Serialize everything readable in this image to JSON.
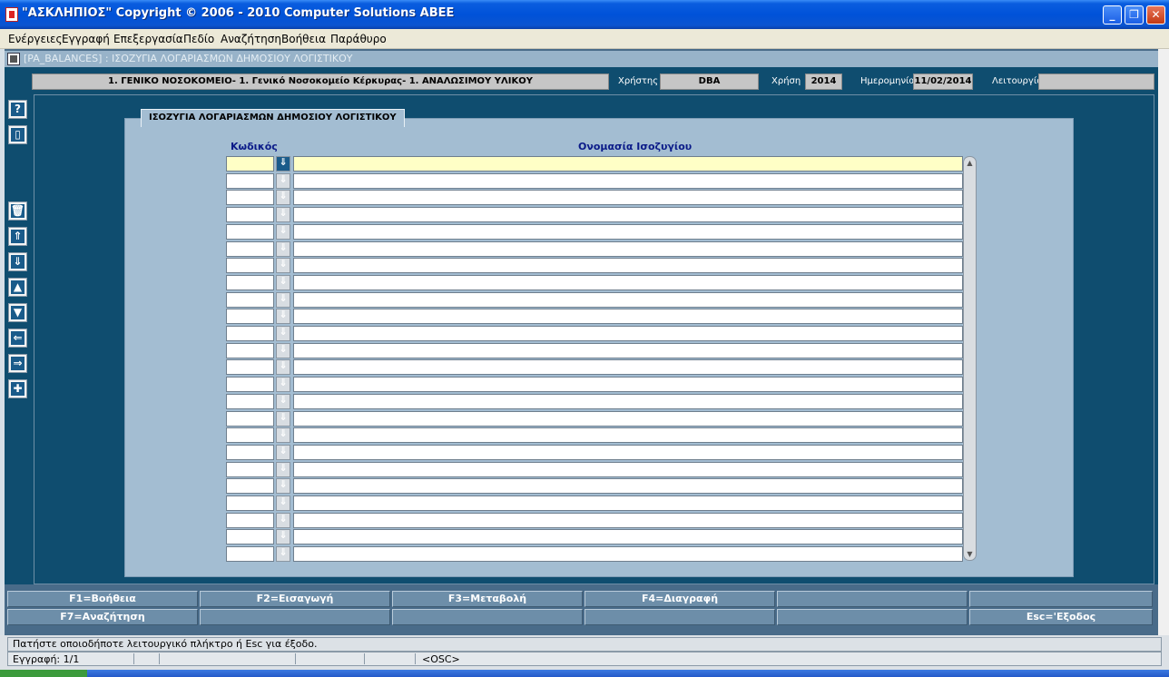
{
  "window": {
    "title": "\"ΑΣΚΛΗΠΙΟΣ\" Copyright © 2006 - 2010 Computer Solutions ABEE",
    "buttons": {
      "minimize": "_",
      "restore": "❐",
      "close": "✕"
    }
  },
  "menu": [
    "Ενέργειες",
    "Εγγραφή",
    "Επεξεργασία",
    "Πεδίο",
    "Αναζήτηση",
    "Βοήθεια",
    "Παράθυρο"
  ],
  "form": {
    "title": "[PA_BALANCES]  :  ΙΣΟΖΥΓΙΑ ΛΟΓΑΡΙΑΣΜΩΝ ΔΗΜΟΣΙΟΥ ΛΟΓΙΣΤΙΚΟΥ",
    "header": {
      "organization": "1. ΓΕΝΙΚΟ ΝΟΣΟΚΟΜΕΙΟ- 1. Γενικό Νοσοκομείο Κέρκυρας- 1. ΑΝΑΛΩΣΙΜΟΥ ΥΛΙΚΟΥ",
      "user_label": "Χρήστης",
      "user": "DBA",
      "year_label": "Χρήση",
      "year": "2014",
      "date_label": "Ημερομηνία",
      "date": "11/02/2014",
      "function_label": "Λειτουργία",
      "function": ""
    },
    "tab_label": "ΙΣΟΖΥΓΙΑ ΛΟΓΑΡΙΑΣΜΩΝ ΔΗΜΟΣΙΟΥ ΛΟΓΙΣΤΙΚΟΥ",
    "columns": {
      "code": "Κωδικός",
      "name": "Ονομασία Ισοζυγίου"
    },
    "toolbar_icons": [
      "help-icon",
      "exit-door-icon",
      "delete-trash-icon",
      "first-record-icon",
      "last-record-icon",
      "previous-record-icon",
      "next-record-icon",
      "previous-block-icon",
      "next-block-icon",
      "insert-record-icon"
    ],
    "toolbar_glyphs": [
      "?",
      "▯",
      "🗑",
      "⇑",
      "⇓",
      "▲",
      "▼",
      "⇐",
      "⇒",
      "✚"
    ]
  },
  "function_keys": {
    "row1": [
      "F1=Βοήθεια",
      "F2=Εισαγωγή",
      "F3=Μεταβολή",
      "F4=Διαγραφή",
      "",
      ""
    ],
    "row2": [
      "F7=Αναζήτηση",
      "",
      "",
      "",
      "",
      "Esc='Εξοδος"
    ]
  },
  "status": {
    "message": "Πατήστε οποιοδήποτε λειτουργικό πλήκτρο ή Esc για έξοδο.",
    "record": "Εγγραφή: 1/1",
    "mode": "<OSC>"
  },
  "colors": {
    "dark_bg": "#0f4d6f",
    "panel": "#a3bdd2",
    "active_row": "#ffffc6",
    "column_header": "#0a1a88"
  }
}
